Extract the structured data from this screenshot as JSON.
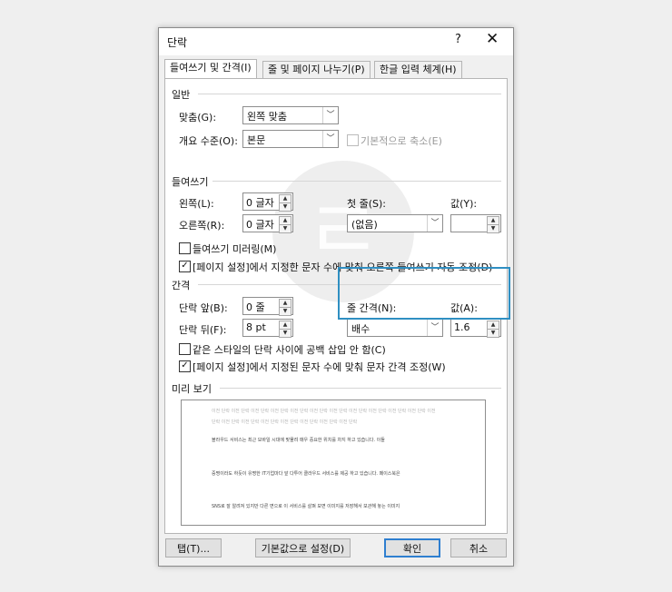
{
  "dialog": {
    "title": "단락",
    "help": "?",
    "close": "✕"
  },
  "tabs": [
    {
      "label": "들여쓰기 및 간격(I)"
    },
    {
      "label": "줄 및 페이지 나누기(P)"
    },
    {
      "label": "한글 입력 체계(H)"
    }
  ],
  "general": {
    "heading": "일반",
    "alignment_label": "맞춤(G):",
    "alignment_value": "왼쪽 맞춤",
    "outline_label": "개요 수준(O):",
    "outline_value": "본문",
    "collapsed_label": "기본적으로 축소(E)"
  },
  "indent": {
    "heading": "들여쓰기",
    "left_label": "왼쪽(L):",
    "left_value": "0 글자",
    "right_label": "오른쪽(R):",
    "right_value": "0 글자",
    "first_line_label": "첫 줄(S):",
    "first_line_value": "(없음)",
    "by_label": "값(Y):",
    "by_value": "",
    "mirror_label": "들여쓰기 미러링(M)",
    "mirror_checked": "",
    "auto_adjust_label": "[페이지 설정]에서 지정한 문자 수에 맞춰 오른쪽 들여쓰기 자동 조정(D)",
    "auto_adjust_checked": "✓"
  },
  "spacing": {
    "heading": "간격",
    "before_label": "단락 앞(B):",
    "before_value": "0 줄",
    "after_label": "단락 뒤(F):",
    "after_value": "8 pt",
    "line_spacing_label": "줄 간격(N):",
    "line_spacing_value": "배수",
    "at_label": "값(A):",
    "at_value": "1.6",
    "no_space_label": "같은 스타일의 단락 사이에 공백 삽입 안 함(C)",
    "no_space_checked": "",
    "grid_label": "[페이지 설정]에서 지정된 문자 수에 맞춰 문자 간격 조정(W)",
    "grid_checked": "✓"
  },
  "preview": {
    "heading": "미리 보기",
    "prev_line1": "이전 단락 이전 단락 이전 단락 이전 단락 이전 단락 이전 단락 이전 단락 이전 단락 이전 단락 이전 단락 이전 단락 이전",
    "prev_line2": "단락 이전 단락 이전 단락 이전 단락 이전 단락 이전 단락 이전 단락 이전 단락",
    "line1": "블라우드 서비스는 최근 모바일 시대에 맞물려 매우 중요한 위치를 차지 하고 있습니다. 이들",
    "line2": "중명이라도 하듯이 유명한 IT기업마다 앞 다투어 클라우드 서비스를 제공 하고 있습니다. 페이스북은",
    "line3": "SNS로 잘 알려져 있지만 다른 면으로 이 서비스를 살펴 보면 이미지를 저장해서 보관해 놓는 이미지"
  },
  "buttons": {
    "tabs": "탭(T)...",
    "default": "기본값으로 설정(D)",
    "ok": "확인",
    "cancel": "취소"
  },
  "watermark": {
    "text": "ㄹ"
  }
}
